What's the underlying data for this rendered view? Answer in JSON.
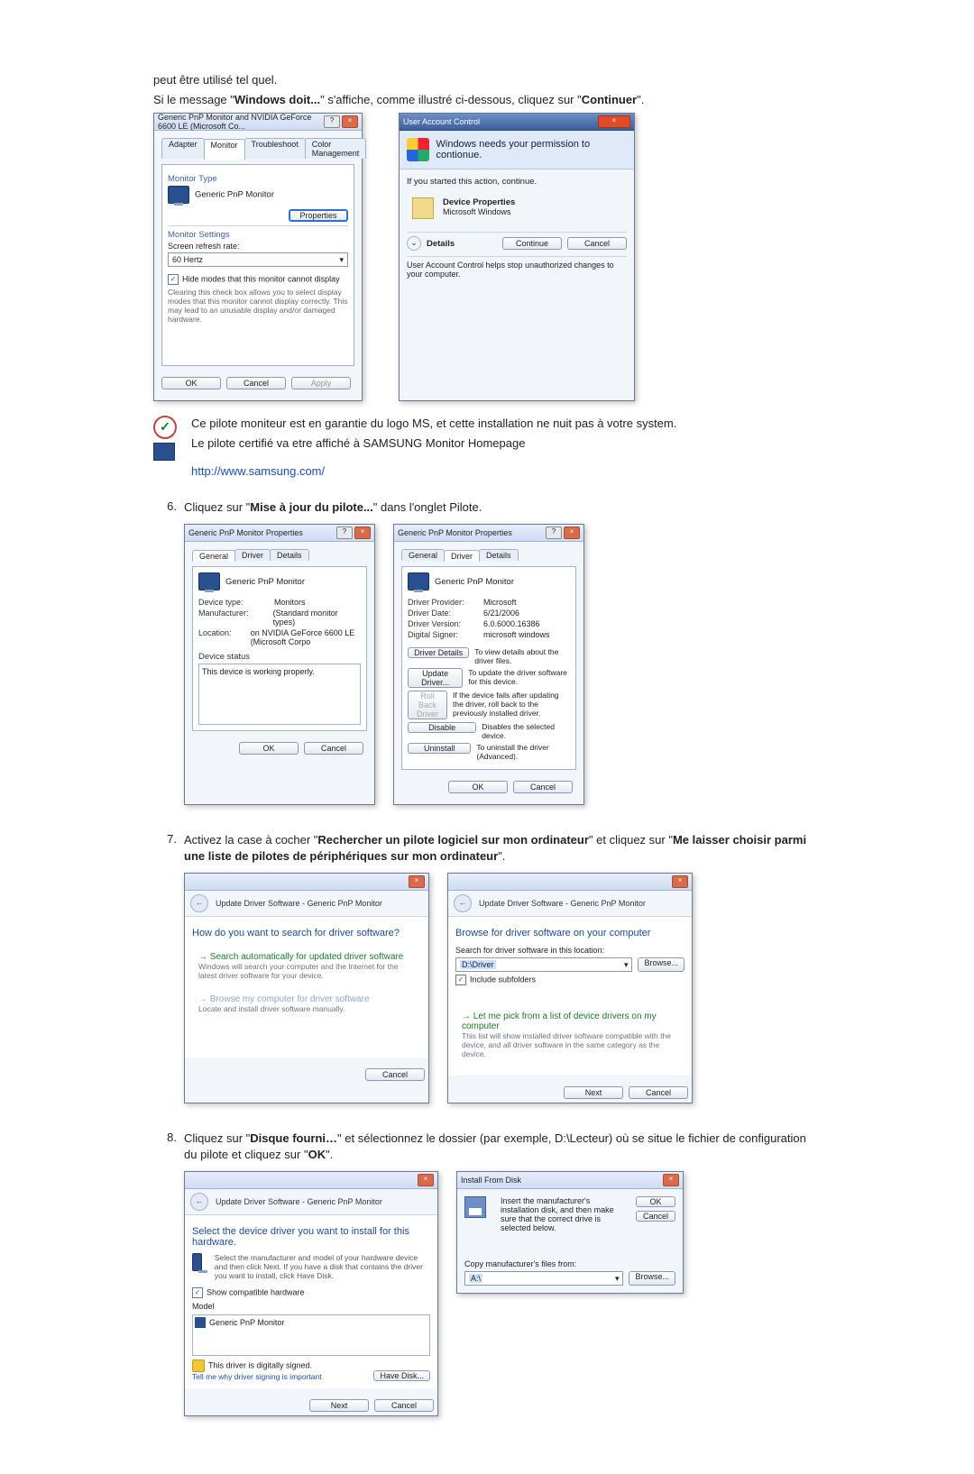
{
  "intro": {
    "line1": "peut être utilisé tel quel.",
    "line2a": "Si le message \"",
    "line2b": "Windows doit...",
    "line2c": "\" s'affiche, comme illustré ci-dessous, cliquez sur \"",
    "line2d": "Continuer",
    "line2e": "\"."
  },
  "monTabWin": {
    "title": "Generic PnP Monitor and NVIDIA GeForce 6600 LE (Microsoft Co...",
    "tabs": {
      "adapter": "Adapter",
      "monitor": "Monitor",
      "troubleshoot": "Troubleshoot",
      "color": "Color Management"
    },
    "monitorTypeLabel": "Monitor Type",
    "monitorType": "Generic PnP Monitor",
    "propertiesBtn": "Properties",
    "monitorSettingsLabel": "Monitor Settings",
    "refreshLabel": "Screen refresh rate:",
    "refreshValue": "60 Hertz",
    "hideModesChk": "Hide modes that this monitor cannot display",
    "hideModesHelp": "Clearing this check box allows you to select display modes that this monitor cannot display correctly. This may lead to an unusable display and/or damaged hardware.",
    "ok": "OK",
    "cancel": "Cancel",
    "apply": "Apply"
  },
  "uac": {
    "title": "User Account Control",
    "headline": "Windows needs your permission to contionue.",
    "ifStarted": "If you started this action, continue.",
    "devProp": "Device Properties",
    "msWin": "Microsoft Windows",
    "details": "Details",
    "continue": "Continue",
    "cancel": "Cancel",
    "footer": "User Account Control helps stop unauthorized changes to your computer."
  },
  "note": {
    "l1": "Ce pilote moniteur est en garantie du logo MS, et cette installation ne nuit pas à votre system.",
    "l2": "Le pilote certifié va etre affiché à SAMSUNG Monitor Homepage",
    "url": "http://www.samsung.com/"
  },
  "step6": {
    "num": "6.",
    "t1": "Cliquez sur \"",
    "t2": "Mise à jour du pilote...",
    "t3": "\" dans l'onglet Pilote."
  },
  "propGen": {
    "title": "Generic PnP Monitor Properties",
    "tabs": {
      "general": "General",
      "driver": "Driver",
      "details": "Details"
    },
    "name": "Generic PnP Monitor",
    "devTypeLbl": "Device type:",
    "devType": "Monitors",
    "mfrLbl": "Manufacturer:",
    "mfr": "(Standard monitor types)",
    "locLbl": "Location:",
    "loc": "on NVIDIA GeForce 6600 LE (Microsoft Corpo",
    "statusLbl": "Device status",
    "statusTxt": "This device is working properly.",
    "ok": "OK",
    "cancel": "Cancel"
  },
  "propDrv": {
    "title": "Generic PnP Monitor Properties",
    "tabs": {
      "general": "General",
      "driver": "Driver",
      "details": "Details"
    },
    "name": "Generic PnP Monitor",
    "provLbl": "Driver Provider:",
    "prov": "Microsoft",
    "dateLbl": "Driver Date:",
    "date": "6/21/2006",
    "verLbl": "Driver Version:",
    "ver": "6.0.6000.16386",
    "sigLbl": "Digital Signer:",
    "sig": "microsoft windows",
    "btnDetails": "Driver Details",
    "txtDetails": "To view details about the driver files.",
    "btnUpdate": "Update Driver...",
    "txtUpdate": "To update the driver software for this device.",
    "btnRoll": "Roll Back Driver",
    "txtRoll": "If the device fails after updating the driver, roll back to the previously installed driver.",
    "btnDisable": "Disable",
    "txtDisable": "Disables the selected device.",
    "btnUninstall": "Uninstall",
    "txtUninstall": "To uninstall the driver (Advanced).",
    "ok": "OK",
    "cancel": "Cancel"
  },
  "step7": {
    "num": "7.",
    "t1": "Activez la case à cocher \"",
    "t2": "Rechercher un pilote logiciel sur mon ordinateur",
    "t3": "\" et cliquez sur \"",
    "t4": "Me laisser choisir parmi une liste de pilotes de périphériques sur mon ordinateur",
    "t5": "\"."
  },
  "wiz1": {
    "crumb": "Update Driver Software - Generic PnP Monitor",
    "headline": "How do you want to search for driver software?",
    "opt1h": "Search automatically for updated driver software",
    "opt1s": "Windows will search your computer and the Internet for the latest driver software for your device.",
    "opt2h": "Browse my computer for driver software",
    "opt2s": "Locate and install driver software manually.",
    "cancel": "Cancel"
  },
  "wiz2": {
    "crumb": "Update Driver Software - Generic PnP Monitor",
    "headline": "Browse for driver software on your computer",
    "searchLbl": "Search for driver software in this location:",
    "path": "D:\\Driver",
    "browse": "Browse...",
    "subChk": "Include subfolders",
    "opt1h": "Let me pick from a list of device drivers on my computer",
    "opt1s": "This list will show installed driver software compatible with the device, and all driver software in the same category as the device.",
    "next": "Next",
    "cancel": "Cancel"
  },
  "step8": {
    "num": "8.",
    "t1": "Cliquez sur \"",
    "t2": "Disque fourni…",
    "t3": "\" et sélectionnez le dossier (par exemple, D:\\Lecteur) où se situe le fichier de configuration du pilote et cliquez sur \"",
    "t4": "OK",
    "t5": "\"."
  },
  "wiz3": {
    "crumb": "Update Driver Software - Generic PnP Monitor",
    "headline": "Select the device driver you want to install for this hardware.",
    "help": "Select the manufacturer and model of your hardware device and then click Next. If you have a disk that contains the driver you want to install, click Have Disk.",
    "compatChk": "Show compatible hardware",
    "modelLbl": "Model",
    "modelItem": "Generic PnP Monitor",
    "signed": "This driver is digitally signed.",
    "tellWhy": "Tell me why driver signing is important",
    "haveDisk": "Have Disk...",
    "next": "Next",
    "cancel": "Cancel"
  },
  "installDisk": {
    "title": "Install From Disk",
    "msg": "Insert the manufacturer's installation disk, and then make sure that the correct drive is selected below.",
    "ok": "OK",
    "cancel": "Cancel",
    "copyLbl": "Copy manufacturer's files from:",
    "path": "A:\\",
    "browse": "Browse..."
  }
}
